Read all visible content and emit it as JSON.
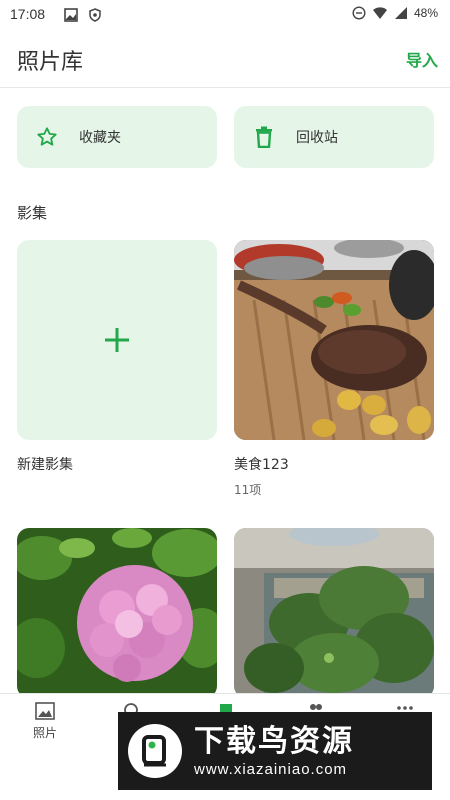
{
  "status_bar": {
    "time": "17:08",
    "battery": "48%"
  },
  "app_bar": {
    "title": "照片库",
    "import_label": "导入"
  },
  "quick_access": {
    "favorites_label": "收藏夹",
    "trash_label": "回收站"
  },
  "albums_section": {
    "title": "影集",
    "items": [
      {
        "name": "新建影集",
        "count": ""
      },
      {
        "name": "美食123",
        "count": "11项"
      }
    ]
  },
  "bottom_nav": {
    "items": [
      {
        "label": "照片",
        "icon": "photo-icon"
      },
      {
        "label": "",
        "icon": "search-icon"
      },
      {
        "label": "",
        "icon": "library-icon"
      },
      {
        "label": "",
        "icon": "people-icon"
      },
      {
        "label": "",
        "icon": "more-icon"
      }
    ]
  },
  "watermark": {
    "title": "下载鸟资源",
    "url": "www.xiazainiao.com"
  },
  "colors": {
    "accent": "#22a84a",
    "card_bg": "#e5f6e8"
  }
}
